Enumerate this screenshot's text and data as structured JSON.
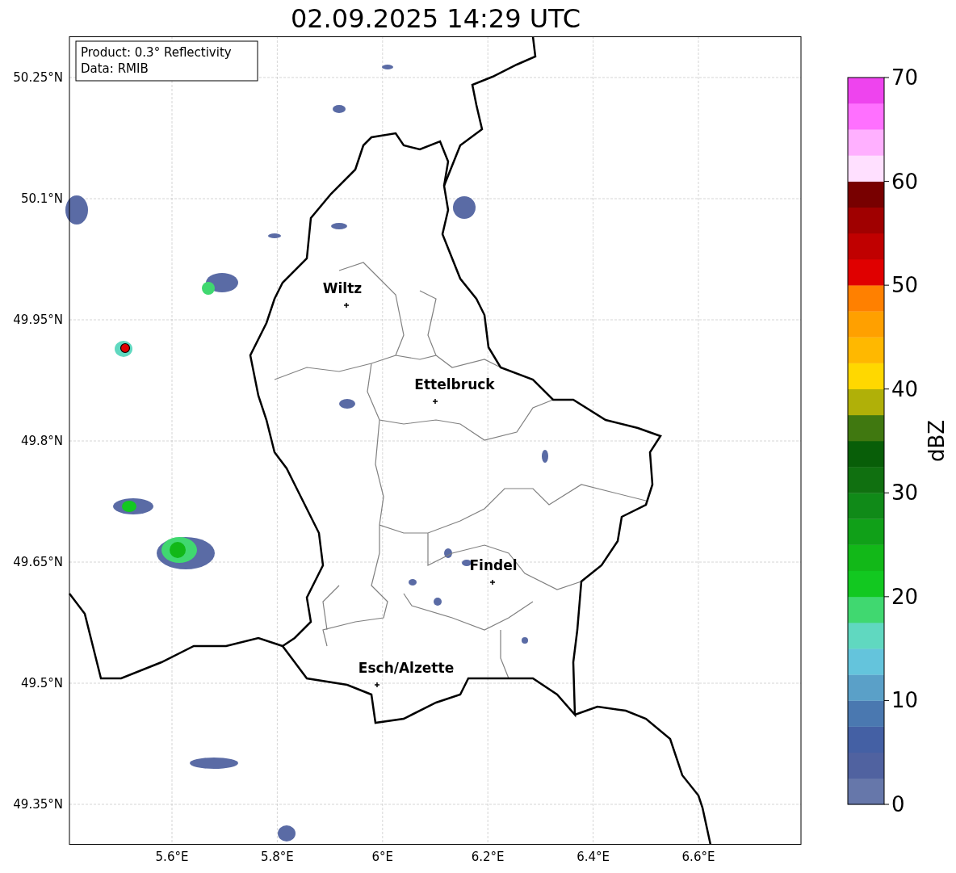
{
  "title": "02.09.2025 14:29 UTC",
  "info_box": [
    "Product: 0.3° Reflectivity",
    "Data: RMIB"
  ],
  "places": [
    {
      "name": "Wiltz"
    },
    {
      "name": "Ettelbruck"
    },
    {
      "name": "Findel"
    },
    {
      "name": "Esch/Alzette"
    }
  ],
  "y_ticks": [
    "50.25°N",
    "50.1°N",
    "49.95°N",
    "49.8°N",
    "49.65°N",
    "49.5°N",
    "49.35°N"
  ],
  "x_ticks": [
    "5.6°E",
    "5.8°E",
    "6°E",
    "6.2°E",
    "6.4°E",
    "6.6°E"
  ],
  "colorbar": {
    "label": "dBZ",
    "ticks": [
      "70",
      "60",
      "50",
      "40",
      "30",
      "20",
      "10",
      "0"
    ],
    "bands": [
      {
        "color": "#6677aa"
      },
      {
        "color": "#5062a0"
      },
      {
        "color": "#4460a4"
      },
      {
        "color": "#4a78b0"
      },
      {
        "color": "#5aa0c8"
      },
      {
        "color": "#64c4dc"
      },
      {
        "color": "#60d8c0"
      },
      {
        "color": "#40d870"
      },
      {
        "color": "#12c820"
      },
      {
        "color": "#12b818"
      },
      {
        "color": "#10a018"
      },
      {
        "color": "#108a18"
      },
      {
        "color": "#107010"
      },
      {
        "color": "#085e08"
      },
      {
        "color": "#407810"
      },
      {
        "color": "#b0b008"
      },
      {
        "color": "#ffd800"
      },
      {
        "color": "#ffb800"
      },
      {
        "color": "#ffa000"
      },
      {
        "color": "#ff8000"
      },
      {
        "color": "#e00000"
      },
      {
        "color": "#c00000"
      },
      {
        "color": "#a00000"
      },
      {
        "color": "#780000"
      },
      {
        "color": "#ffe0ff"
      },
      {
        "color": "#ffb0ff"
      },
      {
        "color": "#ff70ff"
      },
      {
        "color": "#ee44ee"
      }
    ]
  }
}
